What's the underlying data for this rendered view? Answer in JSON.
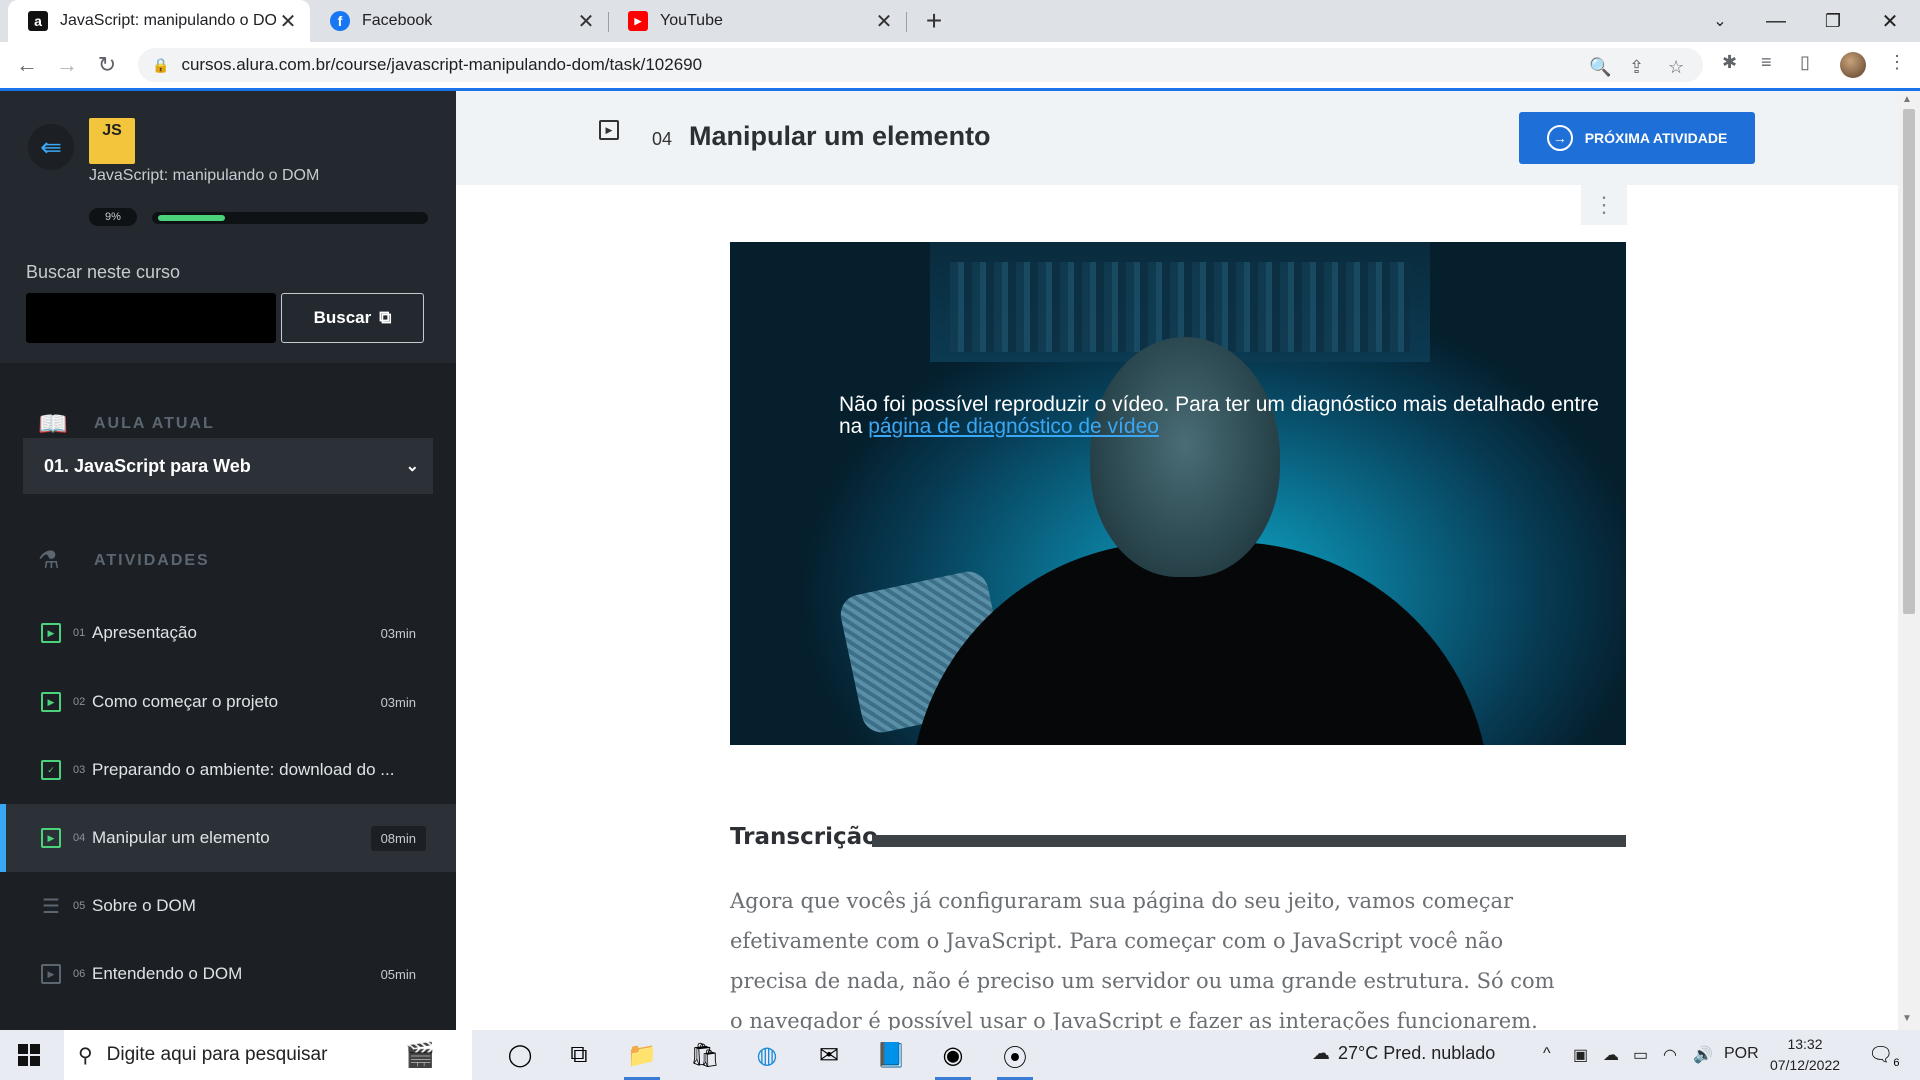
{
  "browser": {
    "tabs": [
      {
        "title": "JavaScript: manipulando o DOM:",
        "favicon": "a",
        "favicon_color": "#111111",
        "active": true
      },
      {
        "title": "Facebook",
        "favicon": "f",
        "favicon_color": "#1877f2",
        "active": false
      },
      {
        "title": "YouTube",
        "favicon": "▶",
        "favicon_color": "#ff0000",
        "active": false
      }
    ],
    "url": "cursos.alura.com.br/course/javascript-manipulando-dom/task/102690"
  },
  "sidebar": {
    "course_logo_text": "JS",
    "course_name": "JavaScript: manipulando o DOM",
    "progress": {
      "label": "9%",
      "value": 0.09
    },
    "search": {
      "label": "Buscar neste curso",
      "value": "",
      "button": "Buscar"
    },
    "current_lesson_heading": "AULA ATUAL",
    "current_lesson": "01. JavaScript para Web",
    "activities_heading": "ATIVIDADES",
    "activities": [
      {
        "num": "01",
        "title": "Apresentação",
        "duration": "03min",
        "icon": "play-icon",
        "current": false
      },
      {
        "num": "02",
        "title": "Como começar o projeto",
        "duration": "03min",
        "icon": "play-icon",
        "current": false
      },
      {
        "num": "03",
        "title": "Preparando o ambiente: download do ...",
        "duration": "",
        "icon": "checklist-icon",
        "current": false
      },
      {
        "num": "04",
        "title": "Manipular um elemento",
        "duration": "08min",
        "icon": "play-icon",
        "current": true
      },
      {
        "num": "05",
        "title": "Sobre o DOM",
        "duration": "",
        "icon": "list-icon",
        "current": false
      },
      {
        "num": "06",
        "title": "Entendendo o DOM",
        "duration": "05min",
        "icon": "play-icon",
        "current": false
      }
    ]
  },
  "main": {
    "task_number": "04",
    "task_title": "Manipular um elemento",
    "next_button": "PRÓXIMA ATIVIDADE",
    "video": {
      "message": "Não foi possível reproduzir o vídeo. Para ter um diagnóstico mais detalhado entre na ",
      "link_text": "página de diagnóstico de vídeo"
    },
    "transcription_heading": "Transcrição",
    "transcription_text": "Agora que vocês já configuraram sua página do seu jeito, vamos começar efetivamente com o JavaScript. Para começar com o JavaScript você não precisa de nada, não é preciso um servidor ou uma grande estrutura. Só com o navegador é possível usar o JavaScript e fazer as interações funcionarem."
  },
  "taskbar": {
    "search_placeholder": "Digite aqui para pesquisar",
    "weather": "27°C  Pred. nublado",
    "language": "POR",
    "time": "13:32",
    "date": "07/12/2022",
    "notification_count": "6"
  },
  "colors": {
    "accent": "#1f6fd8",
    "sidebar_bg": "#1c2025",
    "progress_green": "#4cd27b",
    "current_marker": "#3aa7f5"
  }
}
